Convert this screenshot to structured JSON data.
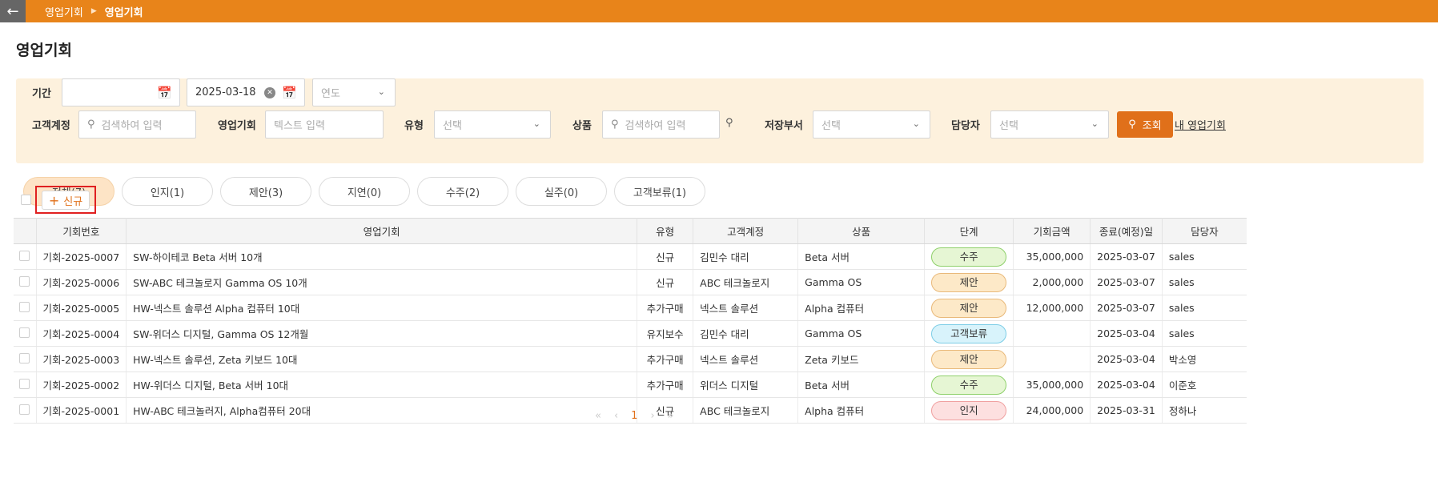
{
  "breadcrumb": {
    "parent": "영업기회",
    "current": "영업기회"
  },
  "page_title": "영업기회",
  "filters": {
    "period_label": "기간",
    "date_start": "",
    "date_end": "2025-03-18",
    "year_placeholder": "연도",
    "customer_label": "고객계정",
    "customer_placeholder": "검색하여 입력",
    "opportunity_label": "영업기회",
    "opportunity_placeholder": "텍스트 입력",
    "type_label": "유형",
    "type_placeholder": "선택",
    "product_label": "상품",
    "product_placeholder": "검색하여 입력",
    "dept_label": "저장부서",
    "dept_placeholder": "선택",
    "owner_label": "담당자",
    "owner_placeholder": "선택",
    "query_label": "조회",
    "my_link": "내 영업기회"
  },
  "tabs": [
    "전체(7)",
    "인지(1)",
    "제안(3)",
    "지연(0)",
    "수주(2)",
    "실주(0)",
    "고객보류(1)"
  ],
  "new_button": "신규",
  "table": {
    "headers": [
      "기회번호",
      "영업기회",
      "유형",
      "고객계정",
      "상품",
      "단계",
      "기회금액",
      "종료(예정)일",
      "담당자"
    ],
    "rows": [
      [
        "기회-2025-0007",
        "SW-하이테코 Beta 서버 10개",
        "신규",
        "김민수 대리",
        "Beta 서버",
        "수주",
        "35,000,000",
        "2025-03-07",
        "sales"
      ],
      [
        "기회-2025-0006",
        "SW-ABC 테크놀로지 Gamma OS 10개",
        "신규",
        "ABC 테크놀로지",
        "Gamma OS",
        "제안",
        "2,000,000",
        "2025-03-07",
        "sales"
      ],
      [
        "기회-2025-0005",
        "HW-넥스트 솔루션 Alpha 컴퓨터 10대",
        "추가구매",
        "넥스트 솔루션",
        "Alpha 컴퓨터",
        "제안",
        "12,000,000",
        "2025-03-07",
        "sales"
      ],
      [
        "기회-2025-0004",
        "SW-위더스 디지털, Gamma OS 12개월",
        "유지보수",
        "김민수 대리",
        "Gamma OS",
        "고객보류",
        "",
        "2025-03-04",
        "sales"
      ],
      [
        "기회-2025-0003",
        "HW-넥스트 솔루션, Zeta 키보드 10대",
        "추가구매",
        "넥스트 솔루션",
        "Zeta 키보드",
        "제안",
        "",
        "2025-03-04",
        "박소영"
      ],
      [
        "기회-2025-0002",
        "HW-위더스 디지털, Beta 서버 10대",
        "추가구매",
        "위더스 디지털",
        "Beta 서버",
        "수주",
        "35,000,000",
        "2025-03-04",
        "이준호"
      ],
      [
        "기회-2025-0001",
        "HW-ABC 테크놀러지, Alpha컴퓨터 20대",
        "신규",
        "ABC 테크놀로지",
        "Alpha 컴퓨터",
        "인지",
        "24,000,000",
        "2025-03-31",
        "정하나"
      ]
    ]
  },
  "pagination": {
    "current": "1"
  },
  "colors": {
    "topbar": "#e8841a",
    "accent": "#e0701a",
    "filter_bg": "#fdf1dd"
  }
}
